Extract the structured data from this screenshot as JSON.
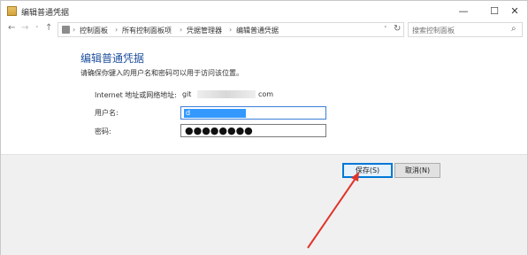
{
  "window": {
    "title": "编辑普通凭据",
    "minimize": "—",
    "maximize": "☐",
    "close": "✕"
  },
  "nav": {
    "back": "←",
    "forward": "→",
    "recent": "˅",
    "up": "↑",
    "breadcrumbs": [
      "控制面板",
      "所有控制面板项",
      "凭据管理器",
      "编辑普通凭据"
    ],
    "separator": "›",
    "dropdown": "˅",
    "refresh": "↻",
    "search_placeholder": "搜索控制面板",
    "search_icon": "⌕"
  },
  "form": {
    "heading": "编辑普通凭据",
    "description": "请确保你键入的用户名和密码可以用于访问该位置。",
    "address_label": "Internet 地址或网络地址:",
    "address_prefix": "git",
    "address_suffix": "com",
    "username_label": "用户名:",
    "username_value": "d",
    "password_label": "密码:",
    "password_value": "●●●●●●●●"
  },
  "buttons": {
    "save": "保存(S)",
    "cancel": "取消(N)"
  },
  "colors": {
    "heading": "#1e4f9c",
    "selection": "#3399ff",
    "focus": "#0078d7",
    "arrow": "#e0342b"
  }
}
